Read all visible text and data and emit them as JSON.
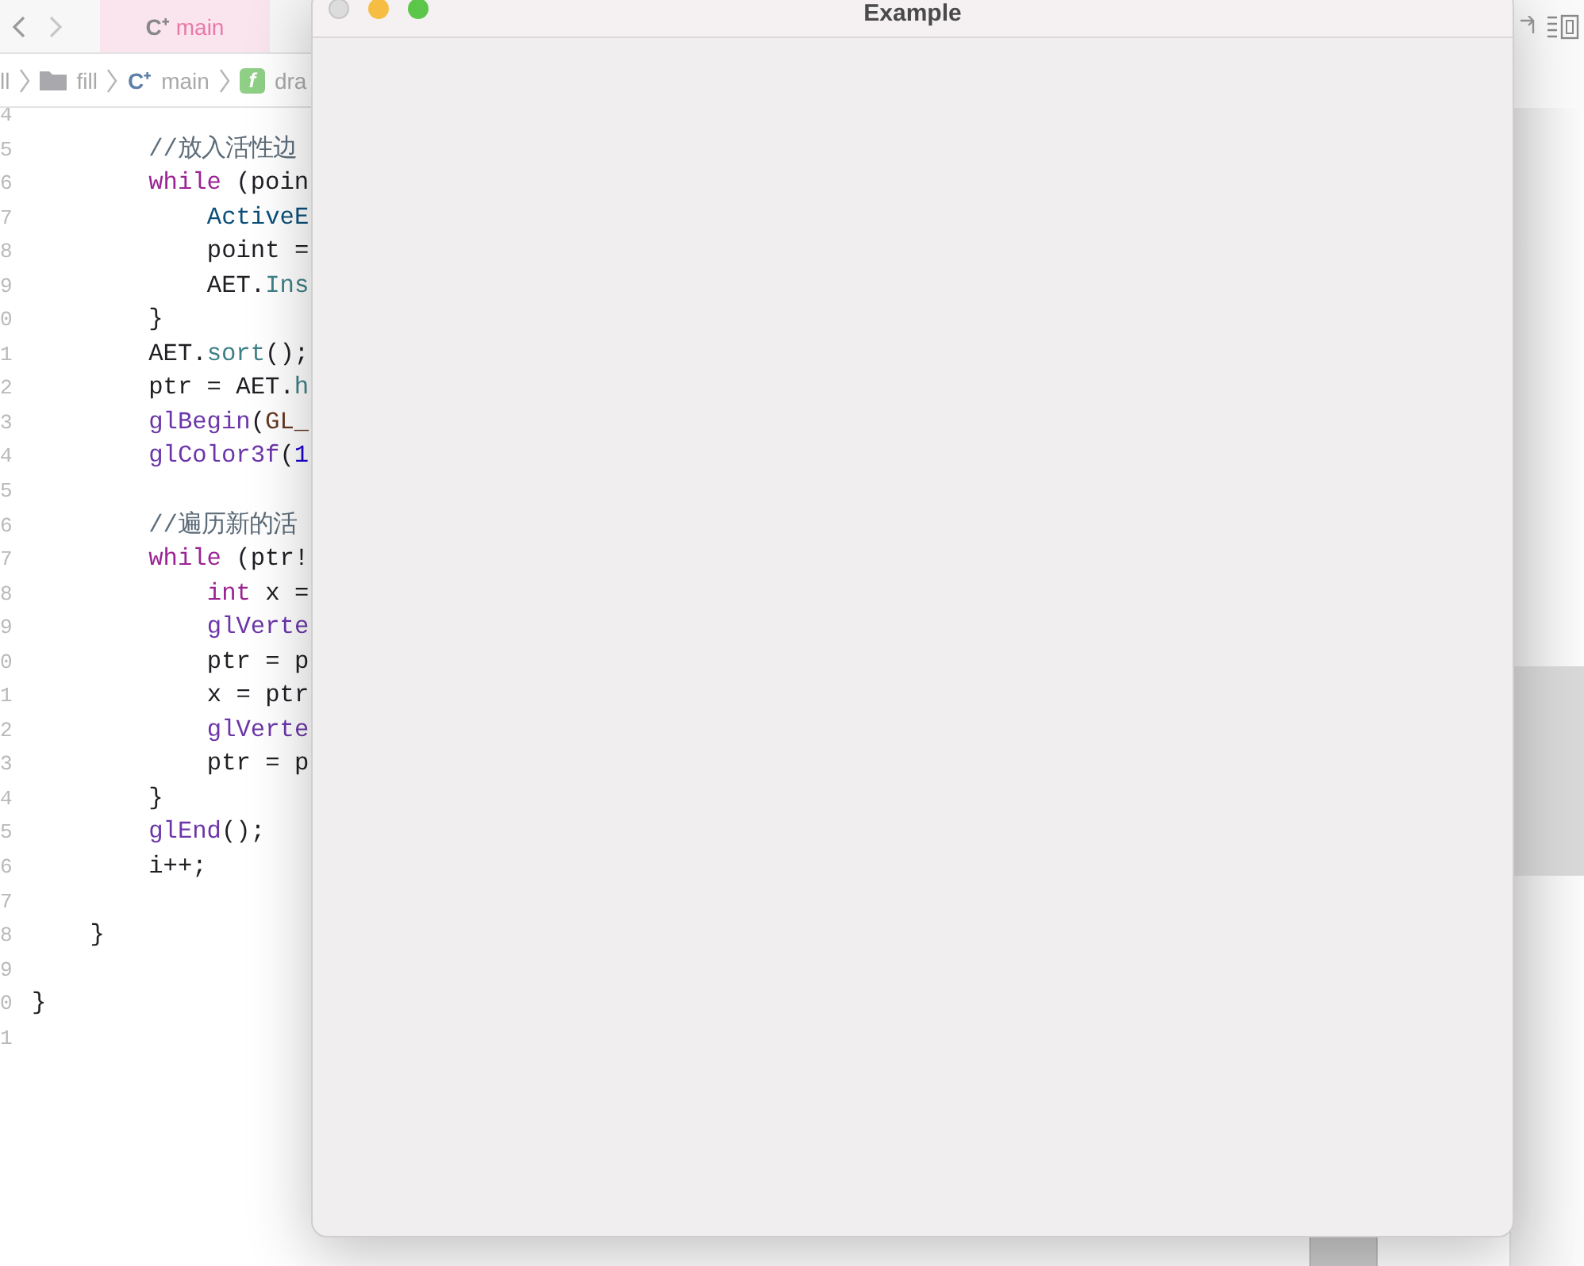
{
  "editor": {
    "tabs": [
      {
        "icon": "C⁺",
        "label": "main",
        "selected": true
      }
    ],
    "breadcrumb": [
      {
        "kind": "text",
        "label": "ll"
      },
      {
        "kind": "folder",
        "label": "fill"
      },
      {
        "kind": "file",
        "badge": "C⁺",
        "label": "main"
      },
      {
        "kind": "function",
        "badge": "f",
        "label": "dra"
      }
    ],
    "lines": [
      {
        "number": "4"
      },
      {
        "number": "5",
        "kind": "body",
        "tokens": [
          {
            "kind": "comment",
            "text": "//放入活性边"
          }
        ]
      },
      {
        "number": "6",
        "kind": "body",
        "tokens": [
          {
            "kind": "keyword",
            "text": "while"
          },
          {
            "kind": "plain",
            "text": " (poin"
          }
        ]
      },
      {
        "number": "7",
        "kind": "inner",
        "tokens": [
          {
            "kind": "type",
            "text": "ActiveE"
          }
        ]
      },
      {
        "number": "8",
        "kind": "inner",
        "tokens": [
          {
            "kind": "plain",
            "text": "point ="
          }
        ]
      },
      {
        "number": "9",
        "kind": "inner",
        "tokens": [
          {
            "kind": "plain",
            "text": "AET."
          },
          {
            "kind": "method",
            "text": "Ins"
          }
        ]
      },
      {
        "number": "0",
        "kind": "body",
        "tokens": [
          {
            "kind": "plain",
            "text": "}"
          }
        ]
      },
      {
        "number": "1",
        "kind": "body",
        "tokens": [
          {
            "kind": "plain",
            "text": "AET."
          },
          {
            "kind": "method",
            "text": "sort"
          },
          {
            "kind": "plain",
            "text": "();"
          }
        ]
      },
      {
        "number": "2",
        "kind": "body",
        "tokens": [
          {
            "kind": "plain",
            "text": "ptr = AET."
          },
          {
            "kind": "method",
            "text": "h"
          }
        ]
      },
      {
        "number": "3",
        "kind": "body",
        "tokens": [
          {
            "kind": "function",
            "text": "glBegin"
          },
          {
            "kind": "plain",
            "text": "("
          },
          {
            "kind": "macro",
            "text": "GL_"
          }
        ]
      },
      {
        "number": "4",
        "kind": "body",
        "tokens": [
          {
            "kind": "function",
            "text": "glColor3f"
          },
          {
            "kind": "plain",
            "text": "("
          },
          {
            "kind": "number",
            "text": "1"
          }
        ]
      },
      {
        "number": "5"
      },
      {
        "number": "6",
        "kind": "body",
        "tokens": [
          {
            "kind": "comment",
            "text": "//遍历新的活"
          }
        ]
      },
      {
        "number": "7",
        "kind": "body",
        "tokens": [
          {
            "kind": "keyword",
            "text": "while"
          },
          {
            "kind": "plain",
            "text": " (ptr!"
          }
        ]
      },
      {
        "number": "8",
        "kind": "inner",
        "tokens": [
          {
            "kind": "keyword",
            "text": "int"
          },
          {
            "kind": "plain",
            "text": " x ="
          }
        ]
      },
      {
        "number": "9",
        "kind": "inner",
        "tokens": [
          {
            "kind": "function",
            "text": "glVerte"
          }
        ]
      },
      {
        "number": "0",
        "kind": "inner",
        "tokens": [
          {
            "kind": "plain",
            "text": "ptr = p"
          }
        ]
      },
      {
        "number": "1",
        "kind": "inner",
        "tokens": [
          {
            "kind": "plain",
            "text": "x = ptr"
          }
        ]
      },
      {
        "number": "2",
        "kind": "inner",
        "tokens": [
          {
            "kind": "function",
            "text": "glVerte"
          }
        ]
      },
      {
        "number": "3",
        "kind": "inner",
        "tokens": [
          {
            "kind": "plain",
            "text": "ptr = p"
          }
        ]
      },
      {
        "number": "4",
        "kind": "body",
        "tokens": [
          {
            "kind": "plain",
            "text": "}"
          }
        ]
      },
      {
        "number": "5",
        "kind": "body",
        "tokens": [
          {
            "kind": "function",
            "text": "glEnd"
          },
          {
            "kind": "plain",
            "text": "();"
          }
        ]
      },
      {
        "number": "6",
        "kind": "body",
        "tokens": [
          {
            "kind": "plain",
            "text": "i++;"
          }
        ]
      },
      {
        "number": "7"
      },
      {
        "number": "8",
        "kind": "block",
        "tokens": [
          {
            "kind": "plain",
            "text": "}"
          }
        ]
      },
      {
        "number": "9"
      },
      {
        "number": "0",
        "kind": "top",
        "tokens": [
          {
            "kind": "plain",
            "text": "}"
          }
        ]
      },
      {
        "number": "1"
      }
    ]
  },
  "window": {
    "title": "Example"
  }
}
